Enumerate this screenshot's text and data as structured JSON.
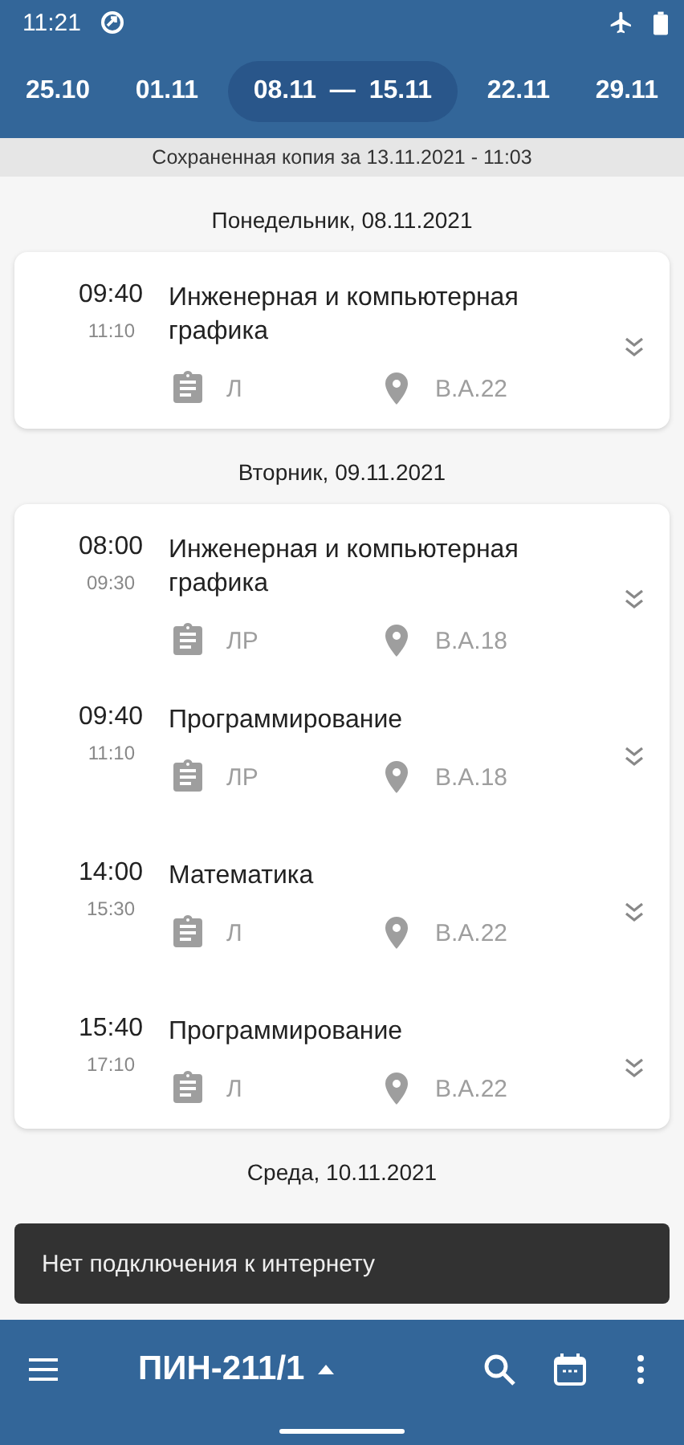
{
  "status_bar": {
    "time": "11:21"
  },
  "weeks": [
    {
      "label": "25.10",
      "selected": false
    },
    {
      "label": "01.11",
      "selected": false
    },
    {
      "label": "08.11 — 15.11",
      "selected": true
    },
    {
      "label": "22.11",
      "selected": false
    },
    {
      "label": "29.11",
      "selected": false
    }
  ],
  "saved_notice": "Сохраненная копия за 13.11.2021 - 11:03",
  "days": [
    {
      "date": "Понедельник, 08.11.2021",
      "lessons": [
        {
          "start": "09:40",
          "end": "11:10",
          "title": "Инженерная и компьютерная графика",
          "type": "Л",
          "room": "В.А.22"
        }
      ]
    },
    {
      "date": "Вторник, 09.11.2021",
      "lessons": [
        {
          "start": "08:00",
          "end": "09:30",
          "title": "Инженерная и компьютерная графика",
          "type": "ЛР",
          "room": "В.А.18"
        },
        {
          "start": "09:40",
          "end": "11:10",
          "title": "Программирование",
          "type": "ЛР",
          "room": "В.А.18"
        },
        {
          "start": "14:00",
          "end": "15:30",
          "title": "Математика",
          "type": "Л",
          "room": "В.А.22"
        },
        {
          "start": "15:40",
          "end": "17:10",
          "title": "Программирование",
          "type": "Л",
          "room": "В.А.22"
        }
      ]
    },
    {
      "date": "Среда, 10.11.2021"
    }
  ],
  "snackbar": "Нет подключения к интернету",
  "bottom_bar": {
    "group": "ПИН-211/1"
  }
}
